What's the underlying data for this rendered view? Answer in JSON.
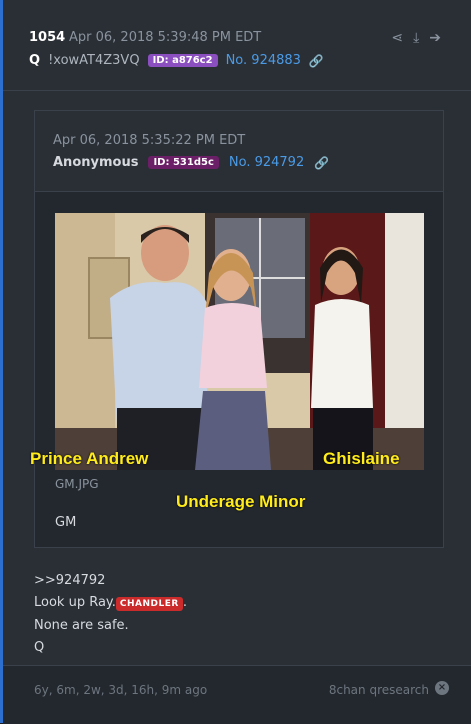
{
  "post": {
    "number": "1054",
    "date": "Apr 06, 2018 5:39:48 PM EDT",
    "name": "Q",
    "trip": "!xowAT4Z3VQ",
    "id": "ID: a876c2",
    "no": "No. 924883"
  },
  "quoted": {
    "date": "Apr 06, 2018 5:35:22 PM EDT",
    "name": "Anonymous",
    "id": "ID: 531d5c",
    "no": "No. 924792",
    "filename": "GM.JPG",
    "text": "GM"
  },
  "captions": {
    "left": "Prince Andrew",
    "right": "Ghislaine",
    "center": "Underage Minor"
  },
  "body": {
    "ref": ">>924792",
    "line2_prefix": "Look up Ray.",
    "tag": "CHANDLER",
    "line2_suffix": ".",
    "line3": "None are safe.",
    "line4": "Q"
  },
  "footer": {
    "ago": "6y, 6m, 2w, 3d, 16h, 9m ago",
    "source": "8chan qresearch"
  },
  "colors": {
    "accent_border": "#2c6fcf",
    "link": "#4a9be6",
    "id_badge": "#8b4fbf",
    "tag": "#cc2b2b",
    "caption": "#ffec1a"
  }
}
